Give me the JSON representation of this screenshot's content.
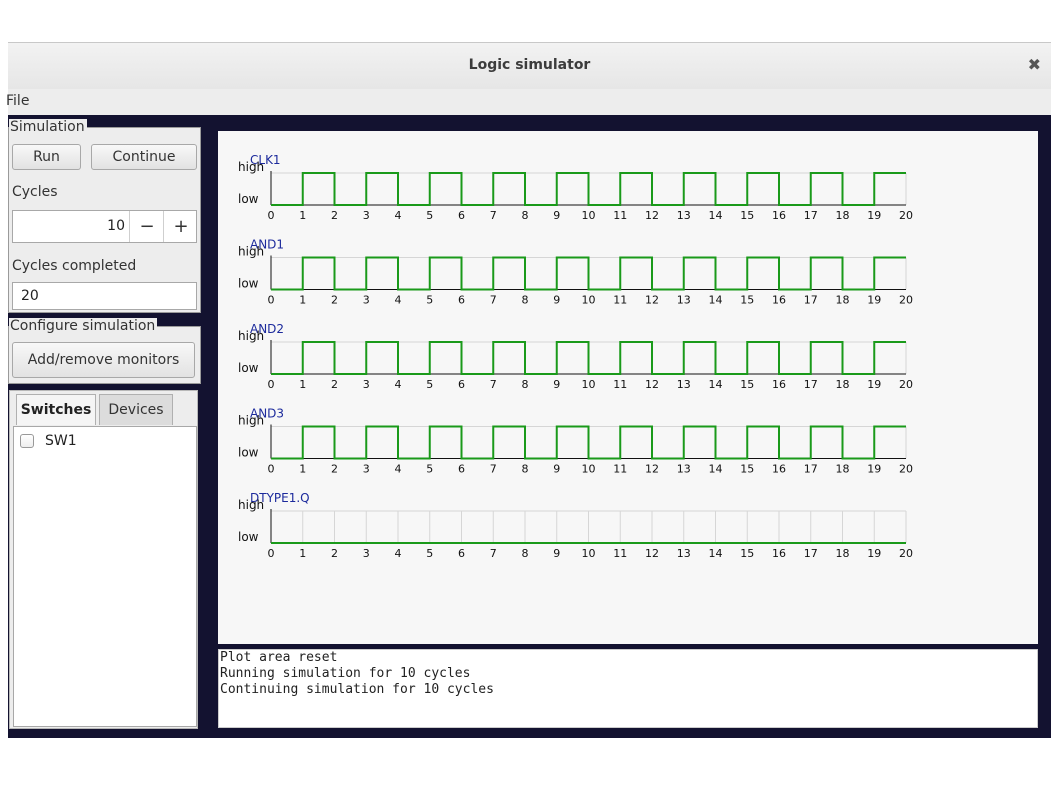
{
  "window": {
    "title": "Logic simulator"
  },
  "menu": {
    "file_label": "File"
  },
  "simulation": {
    "legend": "Simulation",
    "run_label": "Run",
    "continue_label": "Continue",
    "cycles_label": "Cycles",
    "cycles_value": "10",
    "decrement_label": "−",
    "increment_label": "+",
    "completed_label": "Cycles completed",
    "completed_value": "20"
  },
  "configure": {
    "legend": "Configure simulation",
    "monitors_button_label": "Add/remove monitors"
  },
  "tabs": {
    "items": [
      {
        "label": "Switches",
        "active": true
      },
      {
        "label": "Devices",
        "active": false
      }
    ],
    "switches": [
      {
        "label": "SW1",
        "checked": false
      }
    ]
  },
  "chart_data": {
    "type": "line",
    "high_label": "high",
    "low_label": "low",
    "x_ticks": [
      "0",
      "1",
      "2",
      "3",
      "4",
      "5",
      "6",
      "7",
      "8",
      "9",
      "10",
      "11",
      "12",
      "13",
      "14",
      "15",
      "16",
      "17",
      "18",
      "19",
      "20"
    ],
    "line_color": "#1a9a1a",
    "name_color": "#1c2a9c",
    "series": [
      {
        "name": "CLK1",
        "values": [
          0,
          1,
          0,
          1,
          0,
          1,
          0,
          1,
          0,
          1,
          0,
          1,
          0,
          1,
          0,
          1,
          0,
          1,
          0,
          1
        ]
      },
      {
        "name": "AND1",
        "values": [
          0,
          1,
          0,
          1,
          0,
          1,
          0,
          1,
          0,
          1,
          0,
          1,
          0,
          1,
          0,
          1,
          0,
          1,
          0,
          1
        ]
      },
      {
        "name": "AND2",
        "values": [
          0,
          1,
          0,
          1,
          0,
          1,
          0,
          1,
          0,
          1,
          0,
          1,
          0,
          1,
          0,
          1,
          0,
          1,
          0,
          1
        ]
      },
      {
        "name": "AND3",
        "values": [
          0,
          1,
          0,
          1,
          0,
          1,
          0,
          1,
          0,
          1,
          0,
          1,
          0,
          1,
          0,
          1,
          0,
          1,
          0,
          1
        ]
      },
      {
        "name": "DTYPE1.Q",
        "values": [
          0,
          0,
          0,
          0,
          0,
          0,
          0,
          0,
          0,
          0,
          0,
          0,
          0,
          0,
          0,
          0,
          0,
          0,
          0,
          0
        ]
      }
    ]
  },
  "console": {
    "lines": [
      "Plot area reset",
      "Running simulation for 10 cycles",
      "Continuing simulation for 10 cycles"
    ]
  }
}
